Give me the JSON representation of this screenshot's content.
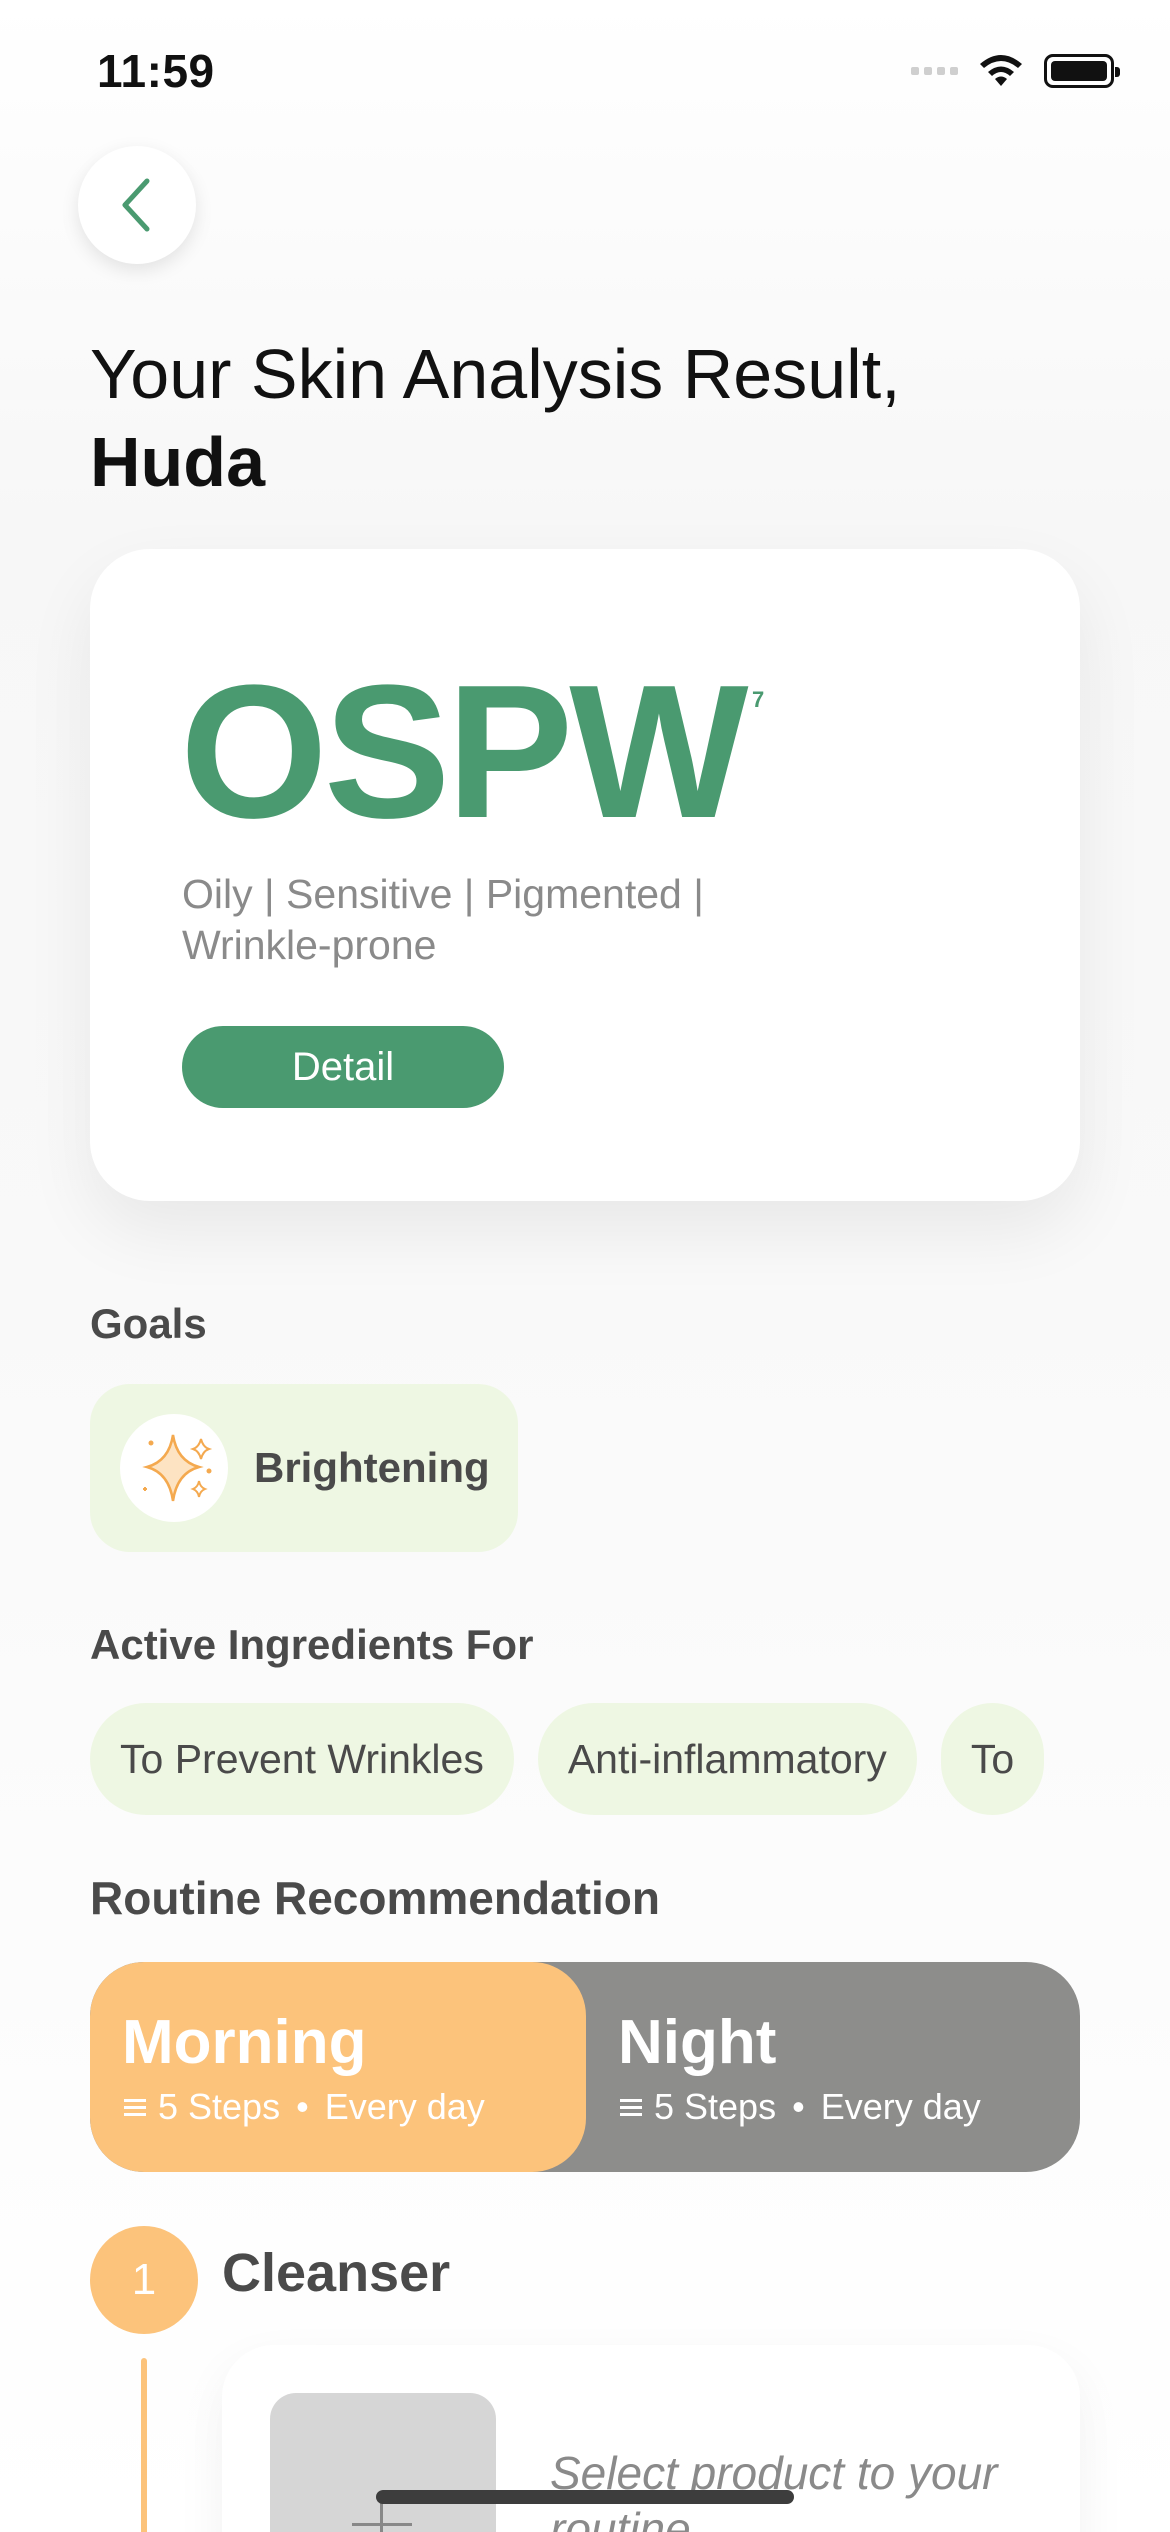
{
  "status_bar": {
    "time": "11:59",
    "icons": [
      "signal-icon",
      "wifi-icon",
      "battery-icon"
    ]
  },
  "nav": {
    "back_icon": "chevron-left-icon"
  },
  "header": {
    "title_line": "Your Skin Analysis Result,",
    "user_name": "Huda"
  },
  "result": {
    "type_code": "OSPW",
    "type_mark": "7",
    "description": "Oily | Sensitive | Pigmented | Wrinkle-prone",
    "detail_label": "Detail"
  },
  "goals": {
    "label": "Goals",
    "items": [
      {
        "label": "Brightening",
        "icon": "sparkle-icon"
      }
    ]
  },
  "ingredients": {
    "label": "Active Ingredients For",
    "chips": [
      "To Prevent Wrinkles",
      "Anti-inflammatory",
      "To"
    ]
  },
  "routine": {
    "label": "Routine Recommendation",
    "tabs": [
      {
        "title": "Morning",
        "steps": "5 Steps",
        "frequency": "Every day",
        "active": true
      },
      {
        "title": "Night",
        "steps": "5 Steps",
        "frequency": "Every day",
        "active": false
      }
    ],
    "step": {
      "number": "1",
      "title": "Cleanser",
      "product_placeholder": "Select product to your routine"
    }
  },
  "colors": {
    "brand_green": "#4a9a70",
    "accent_orange": "#fcc37b",
    "chip_green_bg": "#eef7e3",
    "night_gray": "#8d8d8b"
  }
}
